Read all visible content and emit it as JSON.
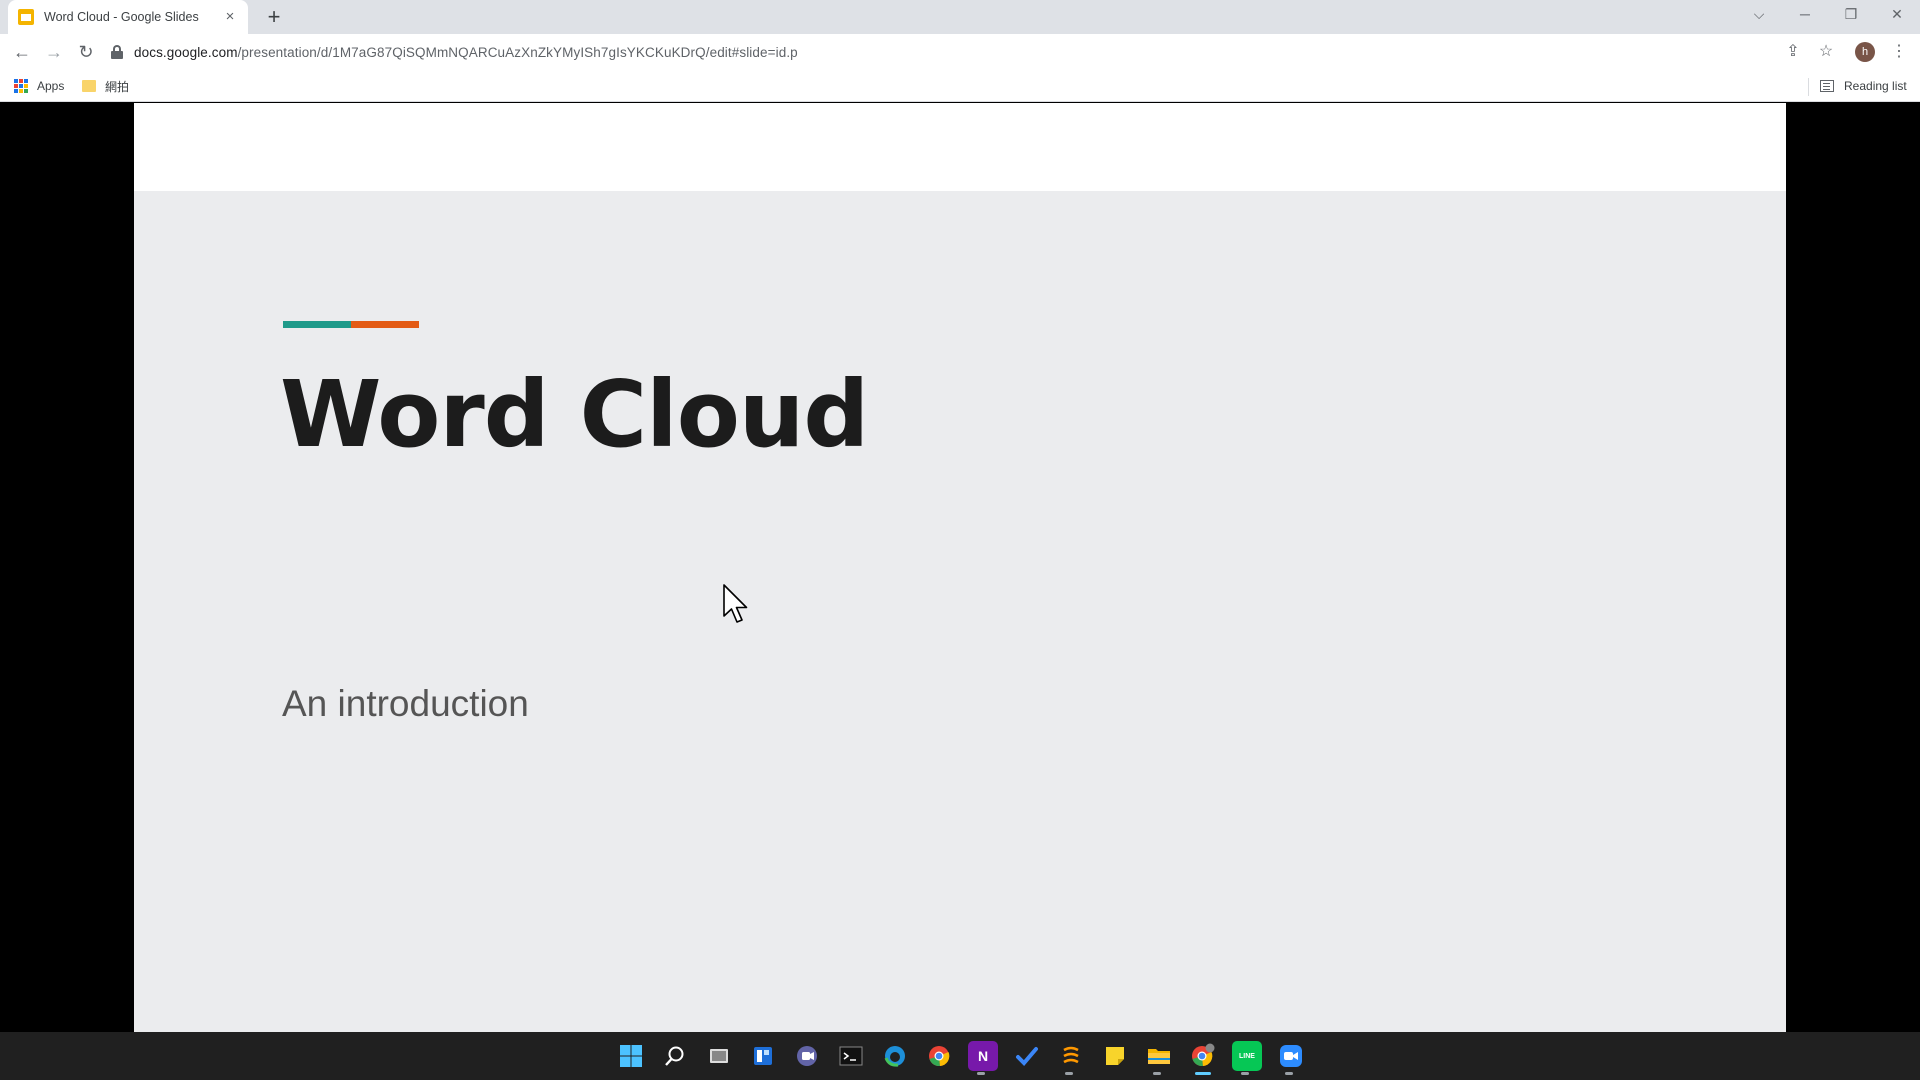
{
  "browser": {
    "tab": {
      "title": "Word Cloud - Google Slides",
      "favicon": "google-slides-icon",
      "close_label": "×"
    },
    "new_tab_label": "+",
    "window_controls": {
      "dropdown": "⌵",
      "minimize": "─",
      "restore": "❐",
      "close": "✕"
    },
    "nav": {
      "back": "←",
      "forward": "→",
      "reload": "↻"
    },
    "address": {
      "host": "docs.google.com",
      "path": "/presentation/d/1M7aG87QiSQMmNQARCuAzXnZkYMyISh7gIsYKCKuKDrQ/edit#slide=id.p"
    },
    "toolbar_right": {
      "share": "⇪",
      "bookmark_star": "☆",
      "menu": "⋮"
    },
    "profile_initial": "h",
    "bookmarks": [
      {
        "label": "Apps",
        "icon": "apps-grid-icon"
      },
      {
        "label": "網拍",
        "icon": "folder-icon"
      }
    ],
    "reading_list_label": "Reading list"
  },
  "slide": {
    "title": "Word Cloud",
    "subtitle": "An introduction",
    "accent_colors": [
      "#1f9a8a",
      "#e35b15"
    ],
    "background": "#ebecee"
  },
  "taskbar": {
    "icons": [
      "windows-start-icon",
      "search-icon",
      "task-view-icon",
      "widgets-icon",
      "teams-chat-icon",
      "terminal-icon",
      "edge-icon",
      "chrome-icon",
      "onenote-icon",
      "todo-icon",
      "sublime-icon",
      "sticky-notes-icon",
      "file-explorer-icon",
      "chrome-profile-icon",
      "line-icon",
      "zoom-icon"
    ],
    "onenote_letter": "N",
    "line_label": "LINE"
  }
}
